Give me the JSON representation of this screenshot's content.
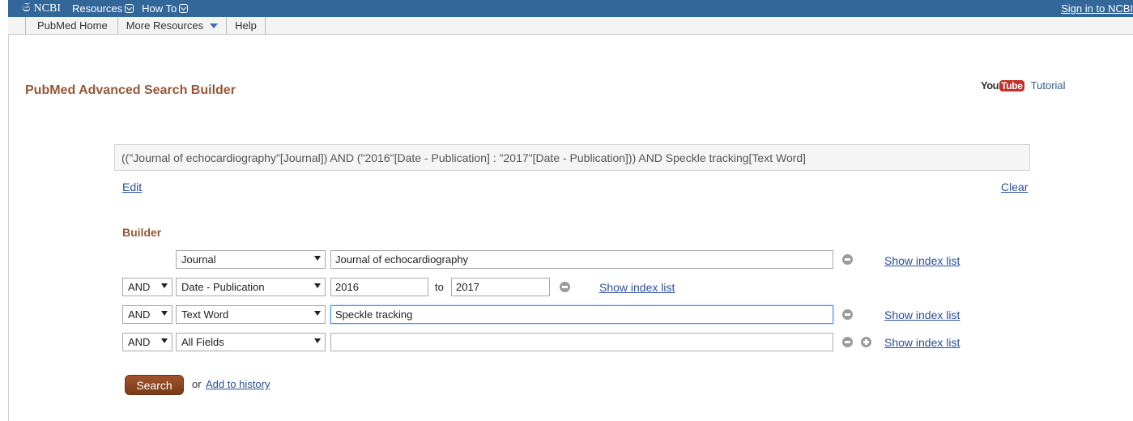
{
  "topbar": {
    "logo": "NCBI",
    "menu": [
      {
        "label": "Resources"
      },
      {
        "label": "How To"
      }
    ],
    "signin": "Sign in to NCBI"
  },
  "subnav": {
    "items": [
      "PubMed Home",
      "More Resources",
      "Help"
    ]
  },
  "page": {
    "title": "PubMed Advanced Search Builder",
    "youtube_you": "You",
    "youtube_tube": "Tube",
    "tutorial": "Tutorial"
  },
  "query": {
    "text": "((\"Journal of echocardiography\"[Journal]) AND (\"2016\"[Date - Publication] : \"2017\"[Date - Publication])) AND Speckle tracking[Text Word]",
    "edit": "Edit",
    "clear": "Clear"
  },
  "builder": {
    "label": "Builder",
    "rows": [
      {
        "operator": "",
        "field": "Journal",
        "value": "Journal of echocardiography",
        "show_index": "Show index list"
      },
      {
        "operator": "AND",
        "field": "Date - Publication",
        "from": "2016",
        "to_label": "to",
        "to": "2017",
        "show_index": "Show index list"
      },
      {
        "operator": "AND",
        "field": "Text Word",
        "value": "Speckle tracking",
        "show_index": "Show index list"
      },
      {
        "operator": "AND",
        "field": "All Fields",
        "value": "",
        "show_index": "Show index list"
      }
    ]
  },
  "actions": {
    "search": "Search",
    "or": "or",
    "add_history": "Add to history"
  },
  "colors": {
    "topbar": "#336699",
    "title": "#985735",
    "link": "#2a4f9e",
    "search_button": "#8b4520"
  }
}
